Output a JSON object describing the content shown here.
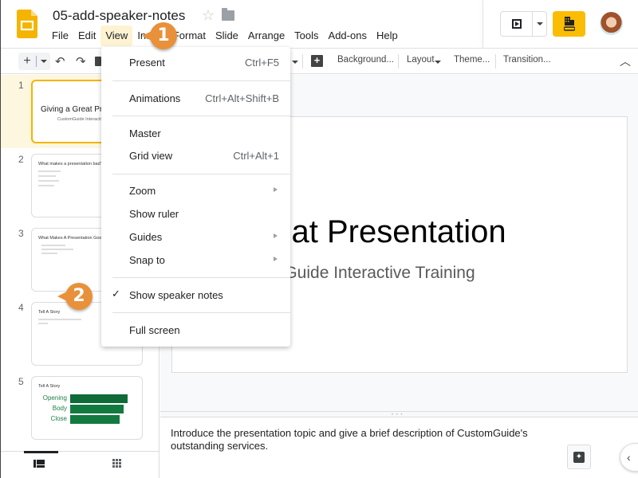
{
  "header": {
    "doc_title": "05-add-speaker-notes",
    "menu": [
      "File",
      "Edit",
      "View",
      "Insert",
      "Format",
      "Slide",
      "Arrange",
      "Tools",
      "Add-ons",
      "Help"
    ],
    "active_menu": "View"
  },
  "toolbar": {
    "background_label": "Background...",
    "layout_label": "Layout",
    "theme_label": "Theme...",
    "transition_label": "Transition..."
  },
  "colors": {
    "accent_yellow": "#fbbc04",
    "selected_slide_bg": "#fef7e0",
    "callout_orange": "#e8913a",
    "story_green": "#137a3f"
  },
  "view_menu": {
    "items": [
      {
        "label": "Present",
        "shortcut": "Ctrl+F5"
      },
      {
        "label": "Animations",
        "shortcut": "Ctrl+Alt+Shift+B"
      },
      {
        "label": "Master",
        "shortcut": ""
      },
      {
        "label": "Grid view",
        "shortcut": "Ctrl+Alt+1"
      },
      {
        "label": "Zoom",
        "submenu": true
      },
      {
        "label": "Show ruler",
        "shortcut": ""
      },
      {
        "label": "Guides",
        "submenu": true
      },
      {
        "label": "Snap to",
        "submenu": true
      },
      {
        "label": "Show speaker notes",
        "checked": true
      },
      {
        "label": "Full screen",
        "shortcut": ""
      }
    ]
  },
  "slides": [
    {
      "num": "1",
      "title": "Giving a Great Presentation",
      "subtitle": "CustomGuide Interactive Training",
      "selected": true
    },
    {
      "num": "2",
      "title": "What makes a presentation bad?"
    },
    {
      "num": "3",
      "title": "What Makes A Presentation Good?"
    },
    {
      "num": "4",
      "title": "Tell A Story"
    },
    {
      "num": "5",
      "title": "Tell A Story",
      "labels": [
        "Opening",
        "Body",
        "Close"
      ]
    }
  ],
  "canvas": {
    "title": "Giving a Great Presentation",
    "subtitle": "CustomGuide Interactive Training"
  },
  "notes": {
    "text": "Introduce the presentation topic and give a brief description of CustomGuide's outstanding services."
  },
  "callouts": [
    "1",
    "2"
  ]
}
